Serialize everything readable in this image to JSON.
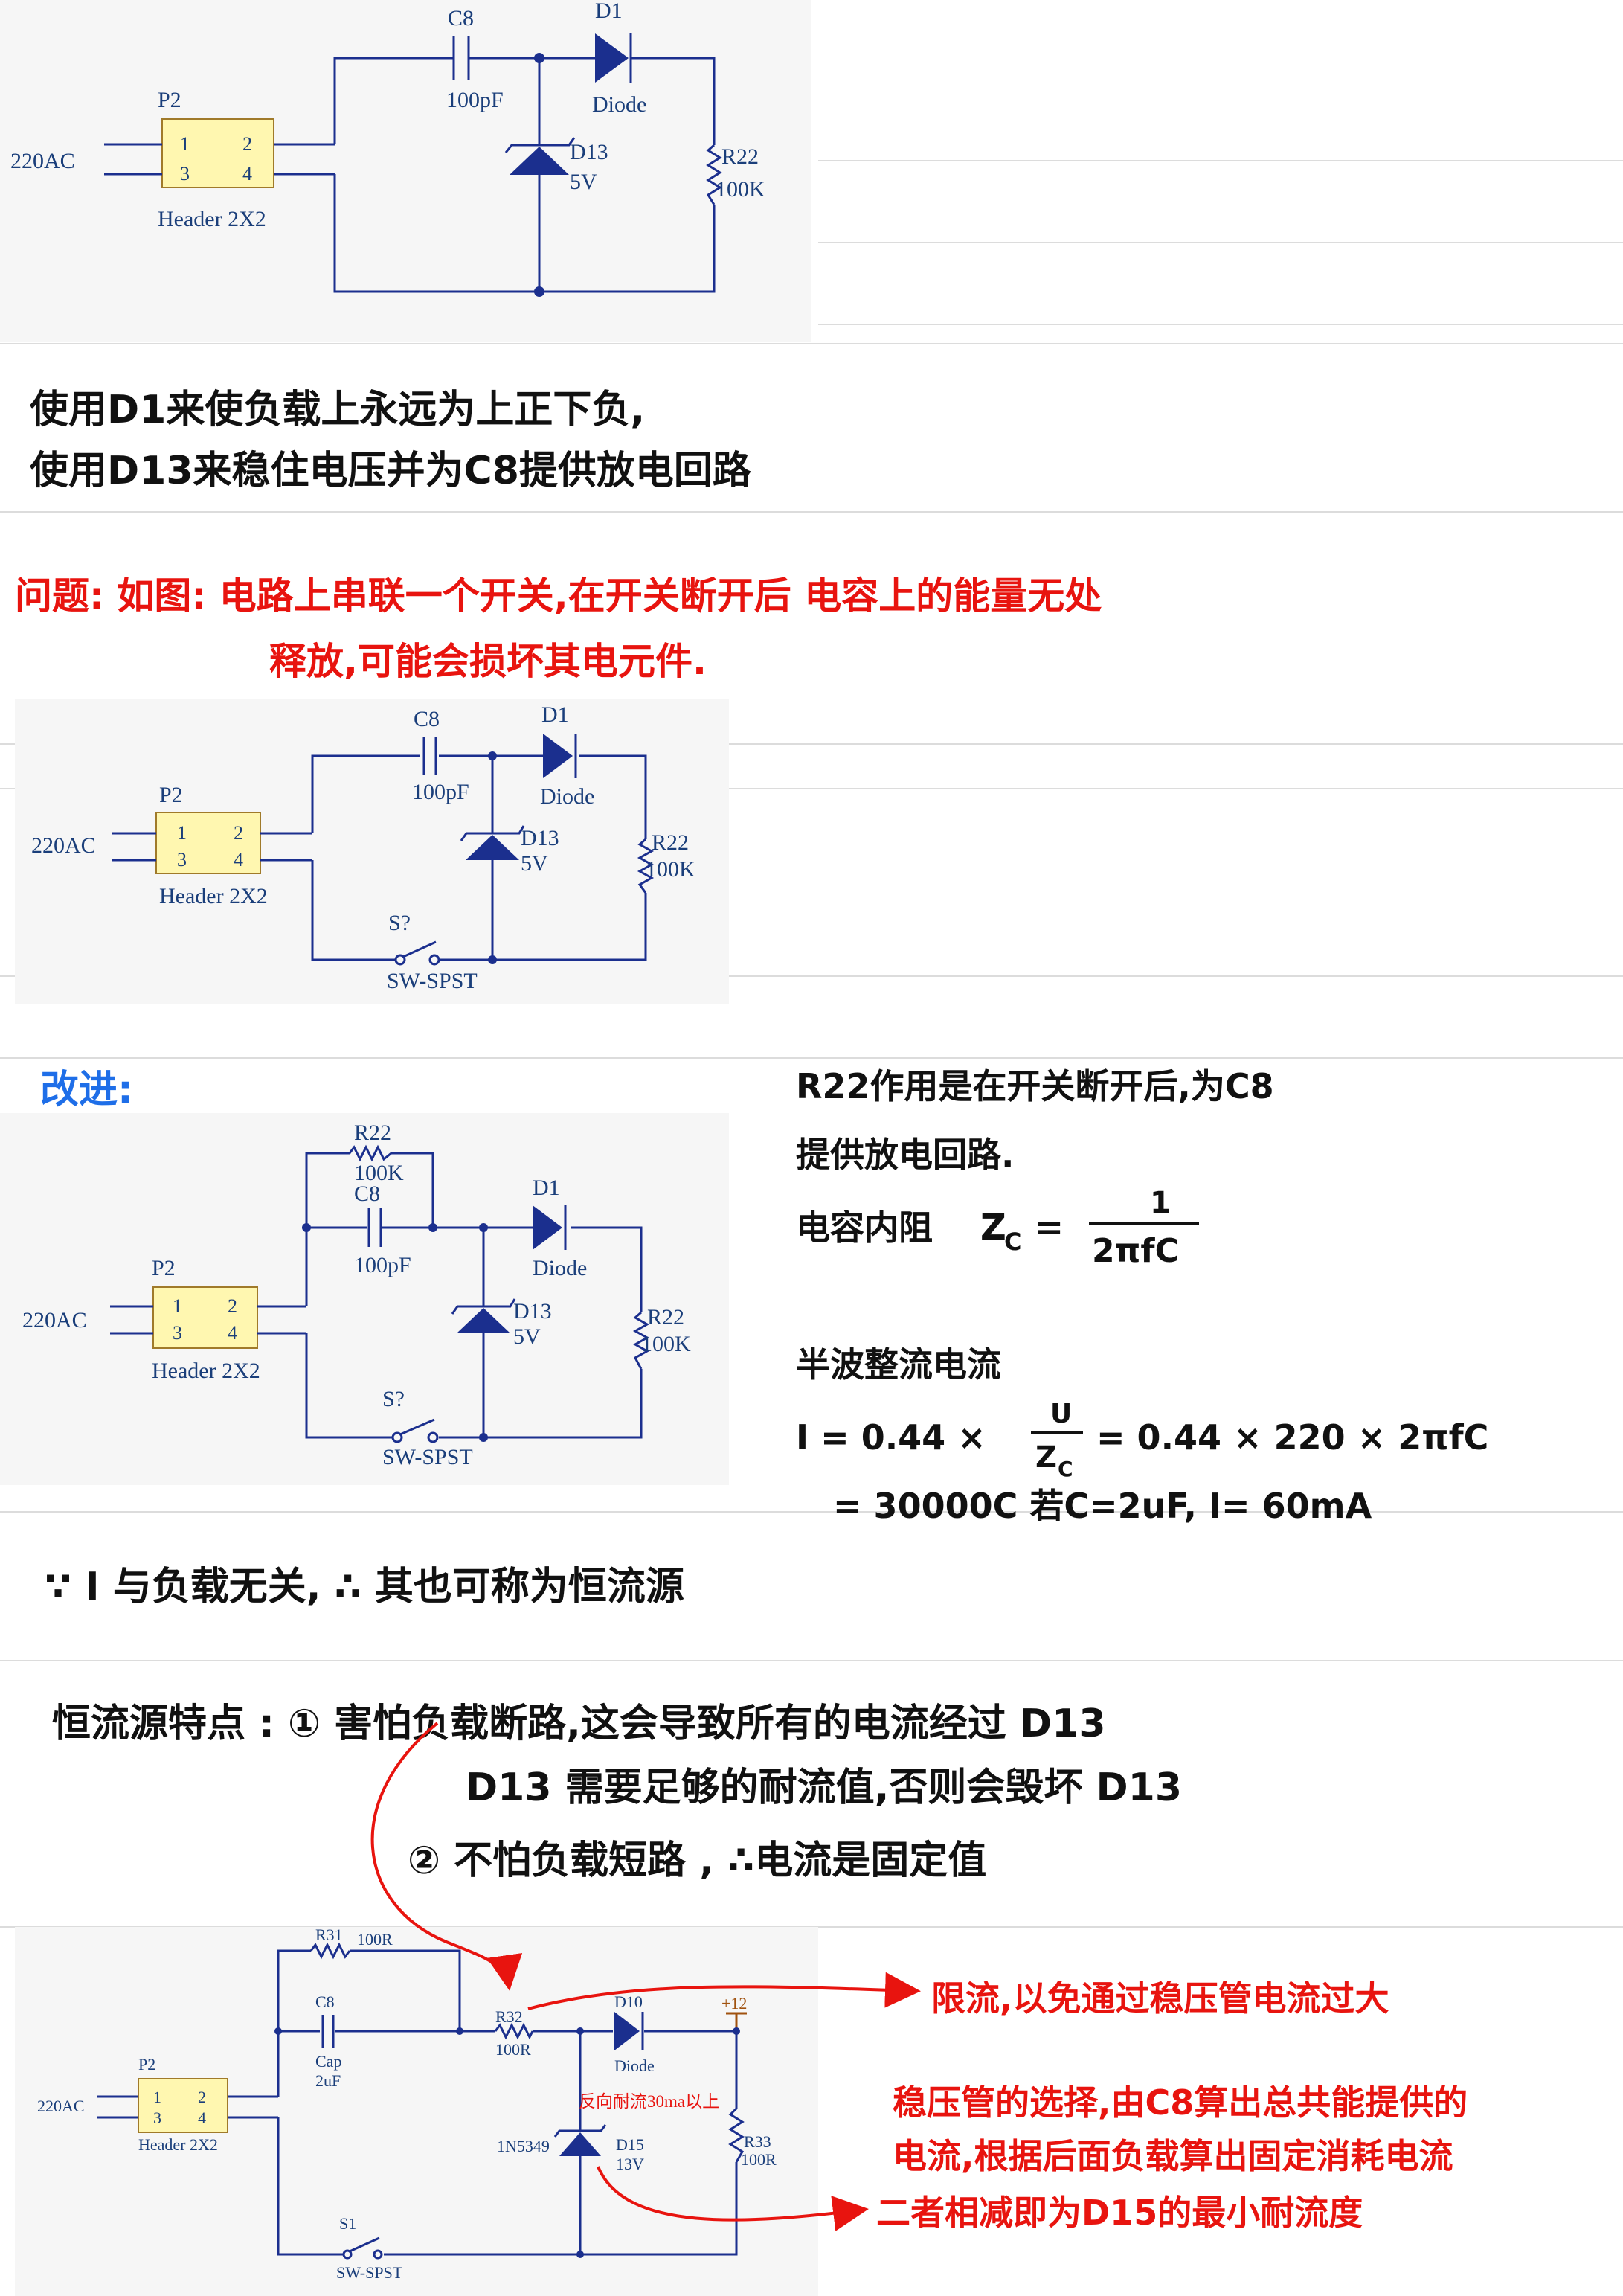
{
  "colors": {
    "wire": "#1b2f8e",
    "label": "#1a3e7a",
    "ink": "#111111",
    "red_ink": "#e8140f",
    "blue_ink": "#1e6ee8",
    "header_fill": "#fff7b0"
  },
  "circuit1": {
    "c8": "C8",
    "c8_val": "100pF",
    "d1": "D1",
    "d1_val": "Diode",
    "d13": "D13",
    "d13_val": "5V",
    "r22": "R22",
    "r22_val": "100K",
    "p2": "P2",
    "pin1": "1",
    "pin2": "2",
    "pin3": "3",
    "pin4": "4",
    "header": "Header 2X2",
    "ac": "220AC"
  },
  "note1": {
    "line1": "使用D1来使负载上永远为上正下负,",
    "line2": "使用D13来稳住电压并为C8提供放电回路"
  },
  "problem": {
    "line1": "问题: 如图: 电路上串联一个开关,在开关断开后 电容上的能量无处",
    "line2": "释放,可能会损坏其电元件."
  },
  "circuit2": {
    "c8": "C8",
    "c8_val": "100pF",
    "d1": "D1",
    "d1_val": "Diode",
    "d13": "D13",
    "d13_val": "5V",
    "r22": "R22",
    "r22_val": "100K",
    "p2": "P2",
    "pin1": "1",
    "pin2": "2",
    "pin3": "3",
    "pin4": "4",
    "header": "Header 2X2",
    "ac": "220AC",
    "sw": "S?",
    "sw_val": "SW-SPST"
  },
  "improve": {
    "label": "改进:"
  },
  "circuit3": {
    "r22": "R22",
    "r22_val": "100K",
    "c8": "C8",
    "c8_val": "100pF",
    "d1": "D1",
    "d1_val": "Diode",
    "d13": "D13",
    "d13_val": "5V",
    "rload": "R22",
    "rload_val": "100K",
    "p2": "P2",
    "pin1": "1",
    "pin2": "2",
    "pin3": "3",
    "pin4": "4",
    "header": "Header 2X2",
    "ac": "220AC",
    "sw": "S?",
    "sw_val": "SW-SPST"
  },
  "right_notes": {
    "line1": "R22作用是在开关断开后,为C8",
    "line2": "提供放电回路.",
    "line3_a": "电容内阻",
    "line3_b": "Z",
    "line3_sub": "C",
    "line3_eq": "=",
    "frac_num": "1",
    "frac_den": "2πfC",
    "line4": "半波整流电流",
    "eq1_a": "I = 0.44 ×",
    "eq1_num": "U",
    "eq1_den": "Z",
    "eq1_den_sub": "C",
    "eq1_b": "= 0.44 × 220 × 2πfC",
    "eq2": "= 30000C   若C=2uF, I= 60mA"
  },
  "note3": {
    "line1": "∵ I 与负载无关, ∴ 其也可称为恒流源"
  },
  "features": {
    "line1": "恒流源特点 :  ① 害怕负载断路,这会导致所有的电流经过 D13",
    "line2": "D13 需要足够的耐流值,否则会毁坏 D13",
    "line3": "② 不怕负载短路 , ∴电流是固定值"
  },
  "circuit4": {
    "r31": "R31",
    "r31_val": "100R",
    "c8": "C8",
    "c8_val": "Cap",
    "c8_val2": "2uF",
    "r32": "R32",
    "r32_val": "100R",
    "d10": "D10",
    "d10_val": "Diode",
    "vcc": "+12",
    "d15": "D15",
    "d15_val": "13V",
    "d15_part": "1N5349",
    "d15_note": "反向耐流30ma以上",
    "r33": "R33",
    "r33_val": "100R",
    "p2": "P2",
    "pin1": "1",
    "pin2": "2",
    "pin3": "3",
    "pin4": "4",
    "header": "Header 2X2",
    "ac": "220AC",
    "sw": "S1",
    "sw_val": "SW-SPST"
  },
  "bottom_notes": {
    "n1": "限流,以免通过稳压管电流过大",
    "n2_line1": "稳压管的选择,由C8算出总共能提供的",
    "n2_line2": "电流,根据后面负载算出固定消耗电流",
    "n3": "二者相减即为D15的最小耐流度"
  }
}
